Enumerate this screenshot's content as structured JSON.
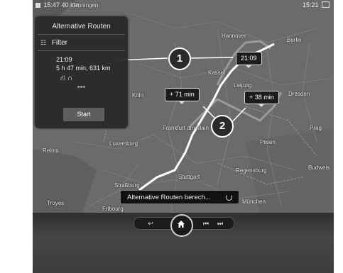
{
  "statusbar": {
    "time_left": "15:47",
    "distance": "40 km",
    "time_right": "15:21"
  },
  "map": {
    "cities": {
      "groningen": "Groningen",
      "hannover": "Hannover",
      "berlin": "Berlin",
      "kassel": "Kassel",
      "leipzig": "Leipzig",
      "koeln": "Köln",
      "dresden": "Dresden",
      "frankfurt": "Frankfurt am Main",
      "prag": "Prag",
      "luxemburg": "Luxemburg",
      "pilsen": "Pilsen",
      "reims": "Reims",
      "stuttgart": "Stuttgart",
      "regensburg": "Regensburg",
      "strassburg": "Straßburg",
      "muenchen": "München",
      "budweis": "Budweis",
      "troyes": "Troyes",
      "freiburg": "Fribourg"
    }
  },
  "panel": {
    "title": "Alternative Routen",
    "filter_label": "Filter",
    "route": {
      "time": "21:09",
      "duration_distance": "5 h 47 min, 631 km"
    },
    "more": "•••",
    "start_label": "Start"
  },
  "bubbles": {
    "main": "21:09",
    "alt1": "+ 71 min",
    "alt2": "+ 38 min"
  },
  "badges": {
    "one": "1",
    "two": "2"
  },
  "toast": {
    "text": "Alternative Routen berech..."
  },
  "controls": {
    "back": "↩",
    "prev": "⏮",
    "next": "⏭"
  },
  "colors": {
    "route_main": "#ffffff",
    "route_alt": "#9a9a9a",
    "map_land": "#6e6e6e",
    "panel_bg": "#282828"
  }
}
